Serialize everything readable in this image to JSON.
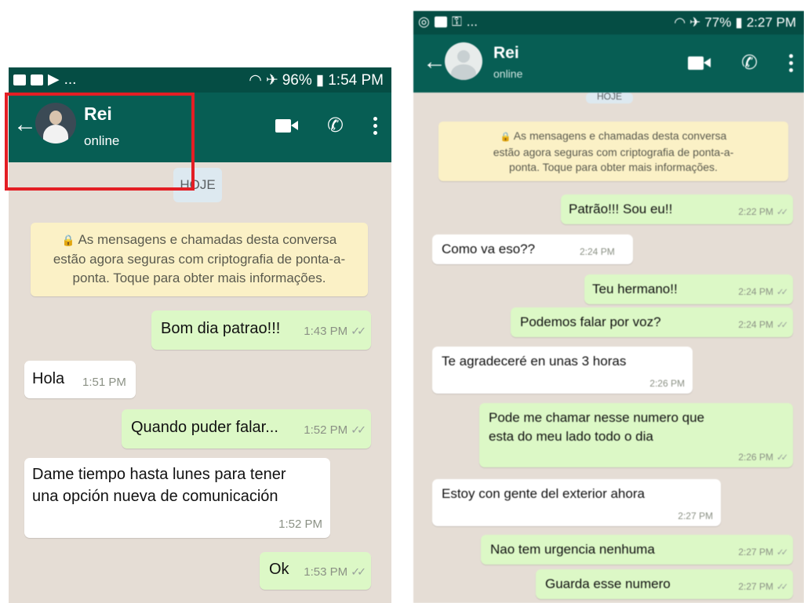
{
  "left_screen": {
    "status_bar": {
      "icons_left": "...",
      "battery": "96%",
      "time": "1:54 PM"
    },
    "header": {
      "contact_name": "Rei",
      "contact_status": "online"
    },
    "date_chip": "HOJE",
    "encryption_notice": [
      "As mensagens e chamadas desta conversa",
      "estão agora seguras com criptografia de ponta-a-",
      "ponta. Toque para obter mais informações."
    ],
    "messages": [
      {
        "direction": "out",
        "text": "Bom dia patrao!!!",
        "time": "1:43 PM"
      },
      {
        "direction": "in",
        "text": "Hola",
        "time": "1:51 PM"
      },
      {
        "direction": "out",
        "text": "Quando puder falar...",
        "time": "1:52 PM"
      },
      {
        "direction": "in",
        "lines": [
          "Dame tiempo hasta lunes para tener",
          "una opción nueva de comunicación"
        ],
        "time": "1:52 PM"
      },
      {
        "direction": "out",
        "text": "Ok",
        "time": "1:53 PM"
      }
    ]
  },
  "right_screen": {
    "status_bar": {
      "icons_left": "...",
      "battery": "77%",
      "time": "2:27 PM"
    },
    "header": {
      "contact_name": "Rei",
      "contact_status": "online"
    },
    "date_chip": "HOJE",
    "encryption_notice": [
      "As mensagens e chamadas desta conversa",
      "estão agora seguras com criptografia de ponta-a-",
      "ponta. Toque para obter mais informações."
    ],
    "messages": [
      {
        "direction": "out",
        "text": "Patrão!!! Sou eu!!",
        "time": "2:22 PM"
      },
      {
        "direction": "in",
        "text": "Como va eso??",
        "time": "2:24 PM"
      },
      {
        "direction": "out",
        "text": "Teu hermano!!",
        "time": "2:24 PM"
      },
      {
        "direction": "out",
        "text": "Podemos falar por voz?",
        "time": "2:24 PM"
      },
      {
        "direction": "in",
        "text": "Te agradeceré en unas 3 horas",
        "time": "2:26 PM"
      },
      {
        "direction": "out",
        "lines": [
          "Pode me chamar nesse numero que",
          "esta do meu lado todo o dia"
        ],
        "time": "2:26 PM"
      },
      {
        "direction": "in",
        "text": "Estoy con gente del exterior ahora",
        "time": "2:27 PM"
      },
      {
        "direction": "out",
        "text": "Nao tem urgencia nenhuma",
        "time": "2:27 PM"
      },
      {
        "direction": "out",
        "text": "Guarda esse numero",
        "time": "2:27 PM"
      }
    ]
  },
  "ticks_glyph": "✓✓",
  "colors": {
    "header": "#075e54",
    "status_bar": "#054d44",
    "outgoing_bubble": "#dcf8c6",
    "incoming_bubble": "#ffffff",
    "chat_background": "#e5ddd5",
    "notice": "#fbf1c6",
    "highlight_box": "#e31e24"
  }
}
